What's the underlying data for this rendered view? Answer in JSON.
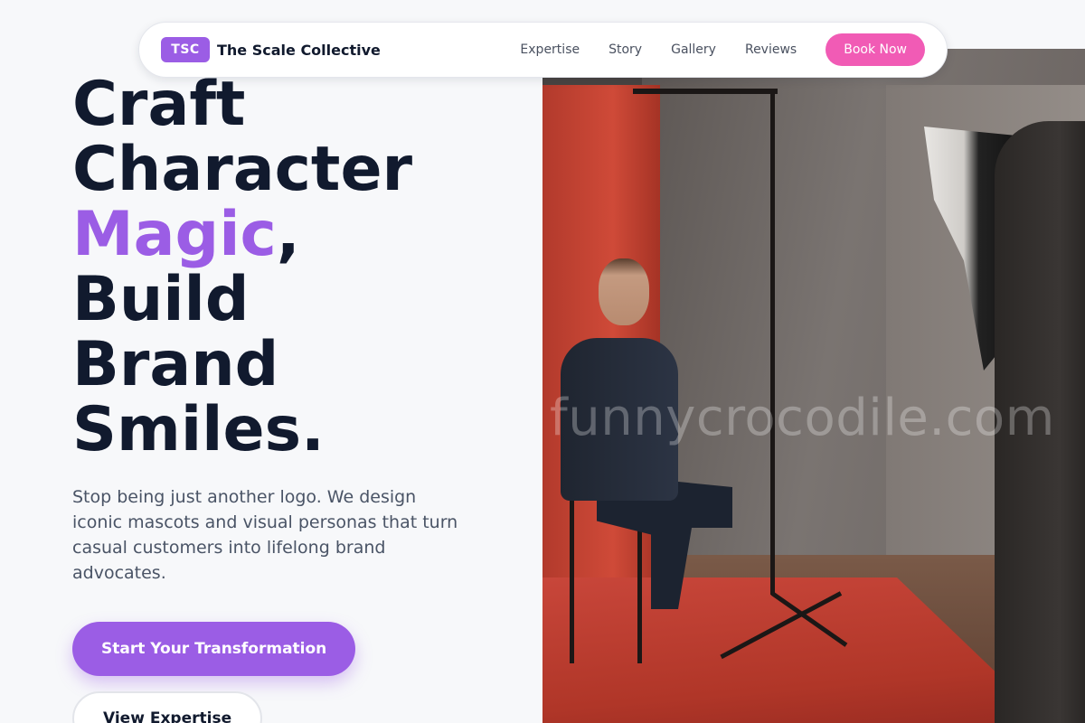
{
  "brand": {
    "badge": "TSC",
    "name": "The Scale Collective"
  },
  "nav": {
    "links": [
      "Expertise",
      "Story",
      "Gallery",
      "Reviews"
    ],
    "book_label": "Book Now"
  },
  "hero": {
    "title_lines": [
      "Craft",
      "Character",
      "Magic",
      ",",
      "Build",
      "Brand",
      "Smiles."
    ],
    "subtitle": "Stop being just another logo. We design iconic mascots and visual personas that turn casual customers into lifelong brand advocates.",
    "primary_cta": "Start Your Transformation",
    "secondary_cta": "View Expertise"
  },
  "photo": {
    "watermark": "funnycrocodile.com"
  },
  "colors": {
    "accent": "#9b5de5",
    "book_button": "#f15bb5",
    "heading": "#111a2e",
    "body_text": "#4a5466",
    "background": "#f7f8fa"
  }
}
